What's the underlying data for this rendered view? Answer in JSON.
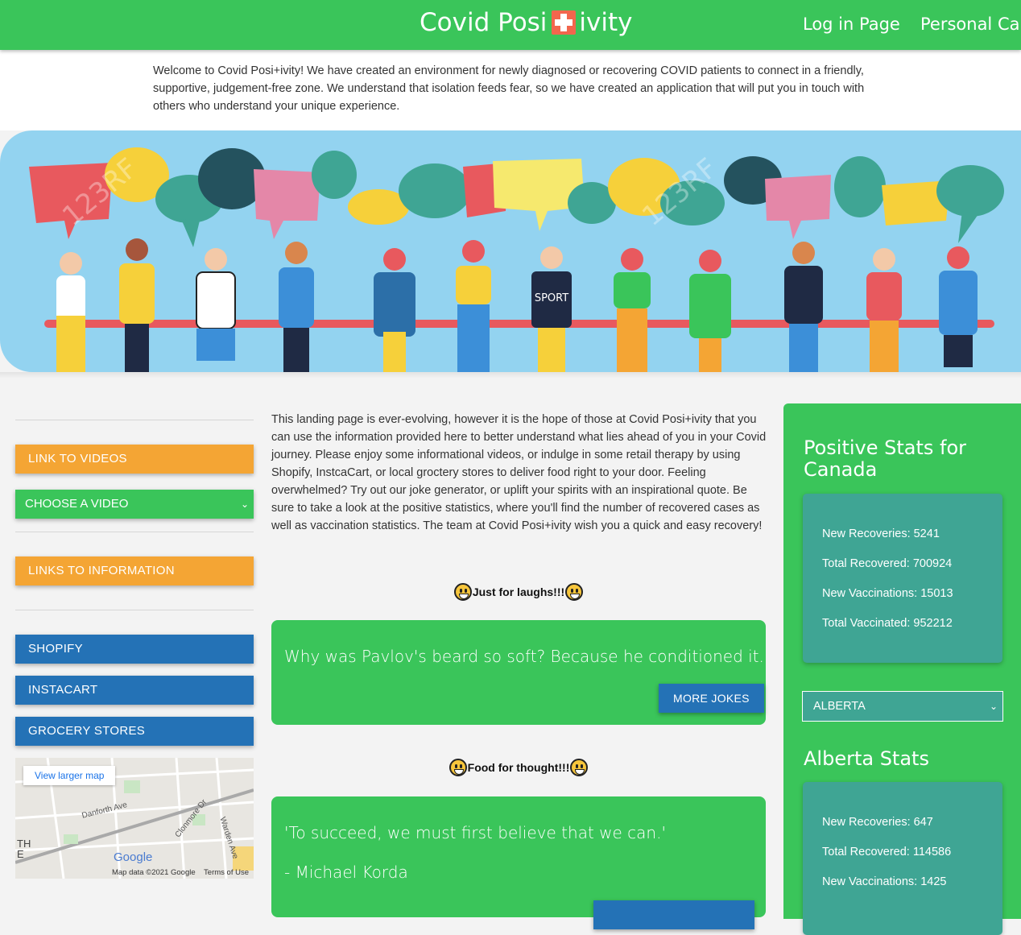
{
  "header": {
    "brand_left": "Covid Posi",
    "brand_right": "ivity",
    "nav": [
      "Log in Page",
      "Personal Care"
    ]
  },
  "welcome": {
    "text": "Welcome to Covid Posi+ivity! We have created an environment for newly diagnosed or recovering COVID patients to connect in a friendly, supportive, judgement-free zone. We understand that isolation feeds fear, so we have created an application that will put you in touch with others who understand your unique experience."
  },
  "hero": {
    "sign_text": "SPORT",
    "watermark": "123RF"
  },
  "sidebar": {
    "link_videos": "LINK TO VIDEOS",
    "choose_video": "CHOOSE A VIDEO",
    "links_info": "LINKS TO INFORMATION",
    "shopify": "SHOPIFY",
    "instacart": "INSTACART",
    "grocery": "GROCERY STORES",
    "map": {
      "view_larger": "View larger map",
      "street1": "Danforth Ave",
      "street2": "Clonmore Dr",
      "street3": "Warden Ave",
      "corner_text": "TH\nE",
      "logo": "Google",
      "footer_data": "Map data ©2021 Google",
      "footer_terms": "Terms of Use"
    }
  },
  "main": {
    "intro": "This landing page is ever-evolving, however it is the hope of those at Covid Posi+ivity that you can use the information provided here to better understand what lies ahead of you in your Covid journey. Please enjoy some informational videos, or indulge in some retail therapy by using Shopify, InstcaCart, or local groctery stores to deliver food right to your door. Feeling overwhelmed? Try out our joke generator, or uplift your spirits with an inspirational quote. Be sure to take a look at the positive statistics, where you'll find the number of recovered cases as well as vaccination statistics. The team at Covid Posi+ivity wish you a quick and easy recovery!",
    "laughs_title": "Just for laughs!!!",
    "joke": "Why was Pavlov's beard so soft? Because he conditioned it.",
    "more_jokes": "MORE JOKES",
    "thought_title": "Food for thought!!!",
    "quote": "'To succeed, we must first believe that we can.'",
    "quote_author": "- Michael Korda"
  },
  "stats": {
    "canada_title": "Positive Stats for Canada",
    "canada": {
      "new_recoveries": "New Recoveries: 5241",
      "total_recovered": "Total Recovered: 700924",
      "new_vaccinations": "New Vaccinations: 15013",
      "total_vaccinated": "Total Vaccinated: 952212"
    },
    "province_selected": "ALBERTA",
    "province_title": "Alberta Stats",
    "province": {
      "new_recoveries": "New Recoveries: 647",
      "total_recovered": "Total Recovered: 114586",
      "new_vaccinations": "New Vaccinations: 1425"
    }
  },
  "colors": {
    "brand_green": "#3ac55a",
    "orange": "#f4a534",
    "blue": "#2472b6",
    "teal": "#3fa594",
    "sky": "#93d3f0"
  }
}
